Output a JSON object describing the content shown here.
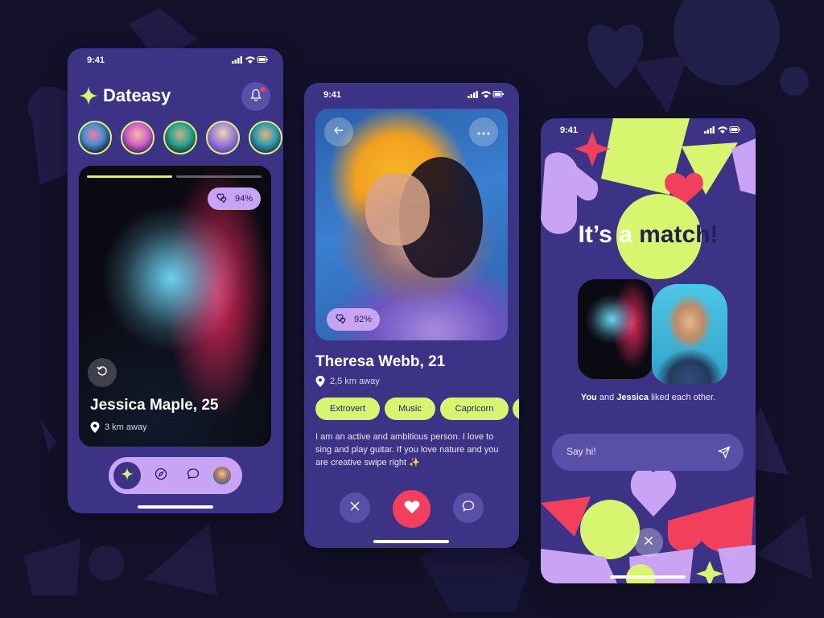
{
  "status": {
    "time": "9:41"
  },
  "screen1": {
    "brand": "Dateasy",
    "match_percent": "94%",
    "profile_name": "Jessica Maple, 25",
    "distance": "3 km away",
    "icons": {
      "logo": "sparkle-icon",
      "notification": "bell-icon",
      "rewind": "undo-icon",
      "location": "location-pin-icon",
      "nav_home": "sparkle-icon",
      "nav_explore": "compass-icon",
      "nav_chat": "chat-icon"
    }
  },
  "screen2": {
    "match_percent": "92%",
    "profile_name": "Theresa Webb, 21",
    "distance": "2,5 km away",
    "tags": [
      "Extrovert",
      "Music",
      "Capricorn"
    ],
    "bio": "I am an active and ambitious person. I love to sing and play guitar. If you love nature and you are creative swipe right ✨",
    "icons": {
      "back": "arrow-left-icon",
      "more": "more-dots-icon",
      "dislike": "close-icon",
      "like": "heart-icon",
      "message": "chat-icon"
    }
  },
  "screen3": {
    "headline_prefix": "It’s a",
    "headline_highlight": "match!",
    "caption_you": "You",
    "caption_and": "and",
    "caption_name": "Jessica",
    "caption_rest": "liked each other.",
    "input_placeholder": "Say hi!",
    "icons": {
      "send": "send-icon",
      "close": "close-icon"
    }
  },
  "colors": {
    "background": "#13112a",
    "phone": "#3c3386",
    "accent_lime": "#d7f56f",
    "accent_lavender": "#c9a4f5",
    "accent_red": "#f2405c"
  }
}
